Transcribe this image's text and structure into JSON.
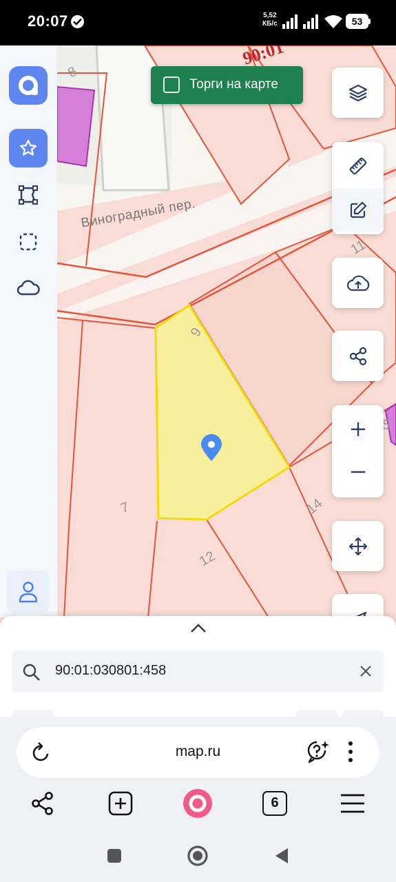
{
  "status_bar": {
    "time": "20:07",
    "net_speed_value": "5,52",
    "net_speed_unit": "КБ/с",
    "battery": "53"
  },
  "map": {
    "street_label": "Виноградный пер.",
    "cadastral_label_top": "90:01",
    "parcel_numbers": [
      "8",
      "9",
      "11",
      "7",
      "12",
      "14",
      "5"
    ],
    "selected_fill": "#f7ef9c",
    "boundary_color": "#e1553a",
    "pin_color": "#4a8bf0"
  },
  "sidebar": {
    "accent": "#5f86ee",
    "items": [
      {
        "icon": "app-logo-icon"
      },
      {
        "icon": "star-icon"
      },
      {
        "icon": "polygon-draw-icon"
      },
      {
        "icon": "dashed-square-icon"
      },
      {
        "icon": "cloud-icon"
      },
      {
        "icon": "user-icon"
      }
    ]
  },
  "torgi": {
    "label": "Торги на карте",
    "checked": false
  },
  "controls": [
    {
      "icon": "layers-icon"
    },
    {
      "icon": "ruler-icon"
    },
    {
      "icon": "edit-icon"
    },
    {
      "icon": "cloud-upload-icon"
    },
    {
      "icon": "share-icon"
    },
    {
      "icon": "plus-icon",
      "label": "+"
    },
    {
      "icon": "minus-icon",
      "label": "−"
    },
    {
      "icon": "move-icon"
    },
    {
      "icon": "navigate-icon"
    }
  ],
  "search": {
    "value": "90:01:030801:458"
  },
  "browser": {
    "url": "map.ru",
    "tabs_count": "6"
  }
}
